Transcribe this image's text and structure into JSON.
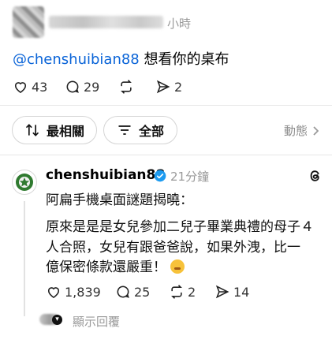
{
  "post": {
    "time": "小時",
    "mention": "@chenshuibian88",
    "text": " 想看你的桌布",
    "actions": {
      "likes": "43",
      "comments": "29",
      "reposts": "",
      "shares": "2"
    }
  },
  "filters": {
    "sort_label": "最相關",
    "filter_label": "全部",
    "activity_label": "動態"
  },
  "reply": {
    "username": "chenshuibian88",
    "time": "21分鐘",
    "lines": [
      "阿扁手機桌面謎題揭曉：",
      "原來是是是女兒參加二兒子畢業典禮的母子４",
      "人合照，女兒有跟爸爸說，如果外洩，比一",
      "億保密條款還嚴重！"
    ],
    "actions": {
      "likes": "1,839",
      "comments": "25",
      "reposts": "2",
      "shares": "14"
    },
    "show_replies": "顯示回覆"
  },
  "colors": {
    "mention": "#0a64d8",
    "muted": "#9a9a9a",
    "verified": "#1d9bf0"
  },
  "icons": [
    "heart-icon",
    "comment-icon",
    "repost-icon",
    "share-icon",
    "sort-icon",
    "filter-icon",
    "chevron-right-icon",
    "verified-badge-icon",
    "threads-icon",
    "emoji-icon"
  ]
}
